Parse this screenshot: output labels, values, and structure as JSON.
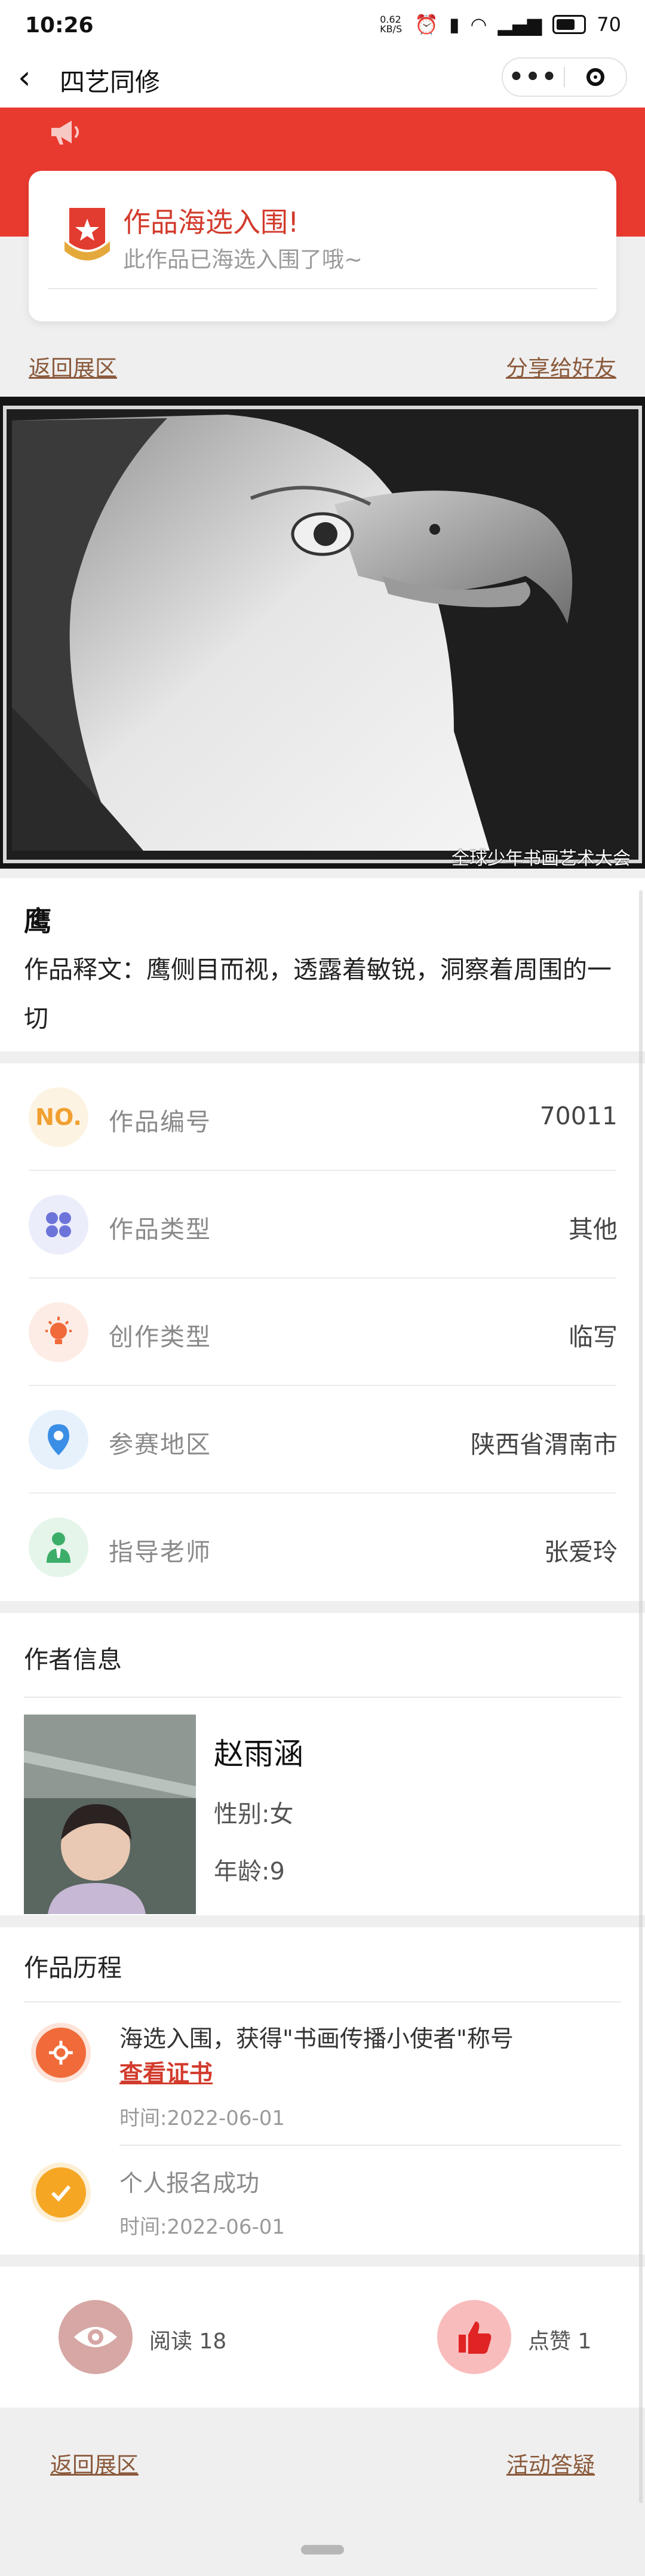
{
  "status": {
    "time": "10:26",
    "net": "0.62 KB/S",
    "battery": "70"
  },
  "nav": {
    "title": "四艺同修"
  },
  "notice": {
    "title": "作品海选入围!",
    "subtitle": "此作品已海选入围了哦~"
  },
  "links": {
    "back_exhibition": "返回展区",
    "share": "分享给好友",
    "faq": "活动答疑"
  },
  "artwork": {
    "watermark": "全球少年书画艺术大会"
  },
  "work": {
    "title": "鹰",
    "caption": "作品释文：鹰侧目而视，透露着敏锐，洞察着周围的一切"
  },
  "info": [
    {
      "icon": "no-icon",
      "icon_text": "NO.",
      "label": "作品编号",
      "value": "70011",
      "color": "#f0a030",
      "bg": "#fdf3e3"
    },
    {
      "icon": "grid-icon",
      "label": "作品类型",
      "value": "其他",
      "color": "#6d74d9",
      "bg": "#ecedfb"
    },
    {
      "icon": "bulb-icon",
      "label": "创作类型",
      "value": "临写",
      "color": "#f06a3a",
      "bg": "#fdece5"
    },
    {
      "icon": "location-icon",
      "label": "参赛地区",
      "value": "陕西省渭南市",
      "color": "#3a8ee6",
      "bg": "#e6f1fc"
    },
    {
      "icon": "teacher-icon",
      "label": "指导老师",
      "value": "张爱玲",
      "color": "#3dae6a",
      "bg": "#e5f5ea"
    }
  ],
  "author": {
    "heading": "作者信息",
    "name": "赵雨涵",
    "gender": "性别:女",
    "age": "年龄:9"
  },
  "history": {
    "heading": "作品历程",
    "items": [
      {
        "text": "海选入围，获得\"书画传播小使者\"称号",
        "link": "查看证书",
        "time": "时间:2022-06-01"
      },
      {
        "text": "个人报名成功",
        "time": "时间:2022-06-01"
      }
    ]
  },
  "stats": {
    "read": "阅读 18",
    "like": "点赞 1"
  },
  "colors": {
    "brand_red": "#e93a30",
    "link_brown": "#8b5a3c"
  }
}
